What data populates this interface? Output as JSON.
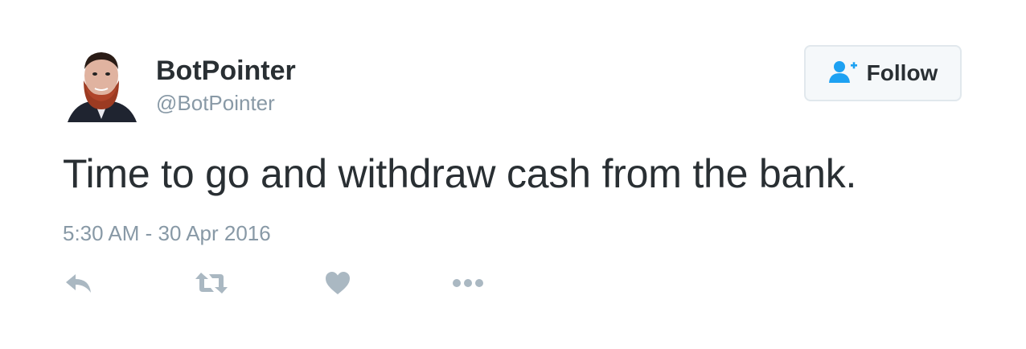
{
  "user": {
    "display_name": "BotPointer",
    "handle": "@BotPointer",
    "avatar_icon": "profile-photo"
  },
  "follow": {
    "label": "Follow",
    "icon": "add-user-icon"
  },
  "tweet": {
    "text": "Time to go and withdraw cash from the bank.",
    "timestamp": "5:30 AM - 30 Apr 2016"
  },
  "actions": {
    "reply_icon": "reply-icon",
    "retweet_icon": "retweet-icon",
    "like_icon": "heart-icon",
    "more_icon": "more-icon"
  },
  "colors": {
    "text": "#292f33",
    "muted": "#8899a6",
    "accent": "#1da1f2",
    "icon": "#aab8c2"
  }
}
